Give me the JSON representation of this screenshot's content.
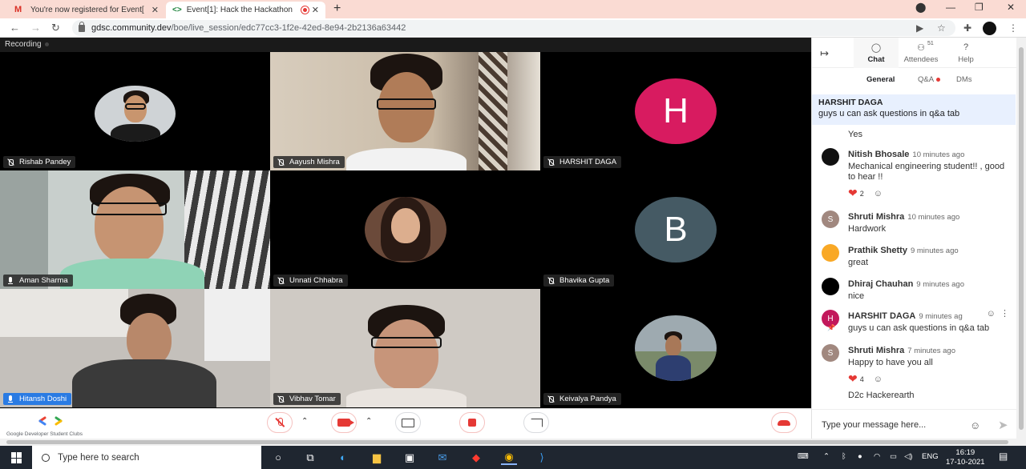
{
  "browser": {
    "tabs": [
      {
        "label": "You're now registered for Event[",
        "icon": "gmail-icon"
      },
      {
        "label": "Event[1]: Hack the Hackathon",
        "icon": "code-icon",
        "recording": true
      }
    ],
    "url_host": "gdsc.community.dev",
    "url_path": "/boe/live_session/edc77cc3-1f2e-42ed-8e94-2b2136a63442"
  },
  "stage": {
    "recording_label": "Recording",
    "participants": [
      {
        "name": "Rishab Pandey",
        "mic": "off"
      },
      {
        "name": "Aayush Mishra",
        "mic": "off"
      },
      {
        "name": "HARSHIT DAGA",
        "mic": "off",
        "initial": "H",
        "color": "#d81b60"
      },
      {
        "name": "Aman Sharma",
        "mic": "on"
      },
      {
        "name": "Unnati Chhabra",
        "mic": "off"
      },
      {
        "name": "Bhavika Gupta",
        "mic": "off",
        "initial": "B",
        "color": "#455a64"
      },
      {
        "name": "Hitansh Doshi",
        "mic": "on"
      },
      {
        "name": "Vibhav Tomar",
        "mic": "off"
      },
      {
        "name": "Keivalya Pandya",
        "mic": "off"
      }
    ]
  },
  "controls": {
    "brand": "Google Developer Student Clubs"
  },
  "panel": {
    "tabs": {
      "chat": "Chat",
      "attendees": "Attendees",
      "attendees_count": "51",
      "help": "Help"
    },
    "subtabs": {
      "general": "General",
      "qa": "Q&A",
      "dms": "DMs"
    },
    "pinned": {
      "author": "HARSHIT DAGA",
      "text": "guys u can ask questions in q&a tab"
    },
    "messages": [
      {
        "text": "Yes"
      },
      {
        "author": "Nitish Bhosale",
        "time": "10 minutes ago",
        "text": "Mechanical engineering student!! , good to hear !!",
        "reactions": "2"
      },
      {
        "author": "Shruti Mishra",
        "time": "10 minutes ago",
        "text": "Hardwork",
        "initial": "S"
      },
      {
        "author": "Prathik Shetty",
        "time": "9 minutes ago",
        "text": "great"
      },
      {
        "author": "Dhiraj Chauhan",
        "time": "9 minutes ago",
        "text": "nice"
      },
      {
        "author": "HARSHIT DAGA",
        "time": "9 minutes ag",
        "text": "guys u can ask questions in q&a tab",
        "initial": "H"
      },
      {
        "author": "Shruti Mishra",
        "time": "7 minutes ago",
        "text": "Happy to have you all",
        "initial": "S",
        "reactions": "4"
      },
      {
        "text": "D2c Hackerearth"
      }
    ],
    "compose_placeholder": "Type your message here..."
  },
  "taskbar": {
    "search_placeholder": "Type here to search",
    "lang": "ENG",
    "time": "16:19",
    "date": "17-10-2021"
  },
  "colors": {
    "accent": "#1a73e8",
    "danger": "#e53935",
    "pinned_bg": "#e8f0fe"
  }
}
